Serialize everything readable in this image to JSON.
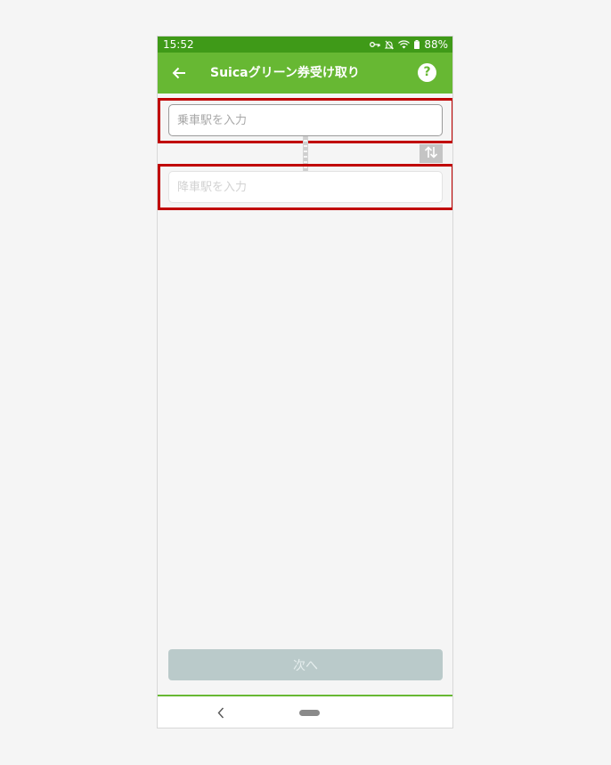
{
  "status_bar": {
    "time": "15:52",
    "battery": "88%",
    "icons": [
      "vpn-key-icon",
      "notifications-off-icon",
      "wifi-icon",
      "battery-icon"
    ]
  },
  "app_bar": {
    "title": "Suicaグリーン券受け取り",
    "back_icon": "arrow-left-icon",
    "help_label": "?",
    "color": "#67b833"
  },
  "form": {
    "departure": {
      "value": "",
      "placeholder": "乗車駅を入力"
    },
    "arrival": {
      "value": "",
      "placeholder": "降車駅を入力"
    },
    "swap_icon": "swap-vertical-icon"
  },
  "next_button": {
    "label": "次へ"
  },
  "nav_bar": {
    "icons": [
      "nav-back-icon",
      "home-pill-icon"
    ]
  },
  "highlight_color": "#c00000"
}
